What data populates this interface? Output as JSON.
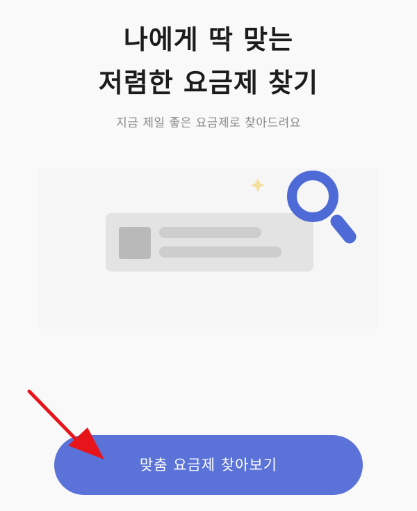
{
  "headline": {
    "line1": "나에게 딱 맞는",
    "line2": "저렴한 요금제 찾기"
  },
  "subtitle": "지금 제일 좋은 요금제로 찾아드려요",
  "illustration": {
    "icons": [
      "sparkle-icon",
      "magnifier-icon",
      "thumbnail-placeholder"
    ]
  },
  "cta": {
    "label": "맞춤 요금제 찾아보기"
  },
  "colors": {
    "accent": "#5b72d8",
    "magnifier": "#4e6ad6",
    "sparkle": "#f5df9c",
    "annotation_arrow": "#e8141b"
  }
}
